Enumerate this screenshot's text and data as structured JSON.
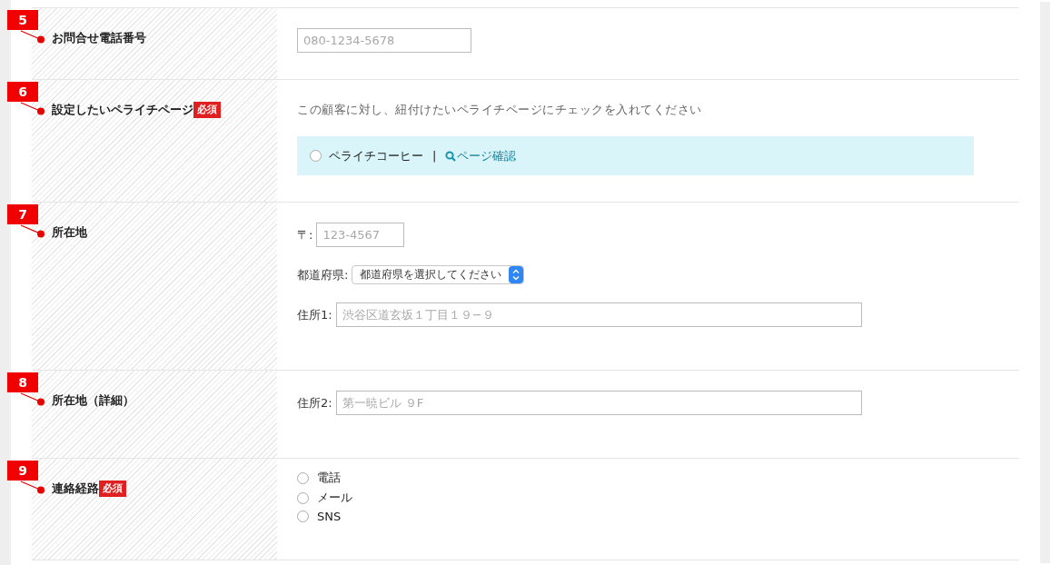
{
  "rows": [
    {
      "number": "5",
      "label": "お問合せ電話番号",
      "kind": "fields",
      "fields": [
        {
          "kind": "phone",
          "placeholder": "080-1234-5678"
        }
      ]
    },
    {
      "number": "6",
      "label": "設定したいペライチページ",
      "badge": "必須",
      "kind": "page_choice",
      "hint": "この顧客に対し、紐付けたいペライチページにチェックを入れてください",
      "options": [
        {
          "label": "ペライチコーヒー",
          "selected": false,
          "separator": "|",
          "link": "ページ確認"
        }
      ]
    },
    {
      "number": "7",
      "label": "所在地",
      "kind": "fields",
      "fields": [
        {
          "kind": "postal",
          "label": "〒:",
          "placeholder": "123-4567"
        },
        {
          "kind": "select",
          "label": "都道府県:",
          "value": "都道府県を選択してください"
        },
        {
          "kind": "address",
          "label": "住所1:",
          "placeholder": "渋谷区道玄坂１丁目１９−９"
        }
      ]
    },
    {
      "number": "8",
      "label": "所在地（詳細）",
      "kind": "fields",
      "fields": [
        {
          "kind": "address",
          "label": "住所2:",
          "placeholder": "第一暁ビル ９F"
        }
      ]
    },
    {
      "number": "9",
      "label": "連絡経路",
      "badge": "必須",
      "kind": "radios",
      "options": [
        {
          "label": "電話",
          "selected": false
        },
        {
          "label": "メール",
          "selected": false
        },
        {
          "label": "SNS",
          "selected": false
        }
      ]
    }
  ]
}
